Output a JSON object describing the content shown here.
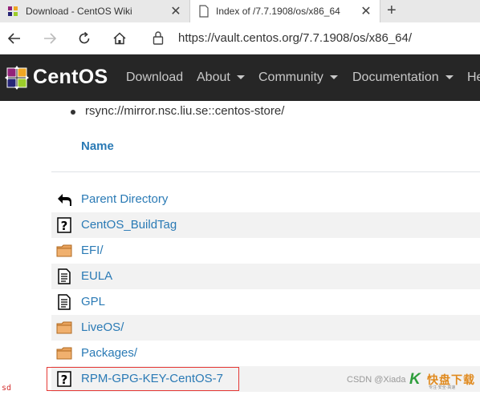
{
  "browser": {
    "tabs": [
      {
        "title": "Download - CentOS Wiki",
        "active": false
      },
      {
        "title": "Index of /7.7.1908/os/x86_64",
        "active": true
      }
    ],
    "new_tab_glyph": "+",
    "close_glyph": "✕",
    "url": "https://vault.centos.org/7.7.1908/os/x86_64/"
  },
  "site": {
    "brand": "CentOS",
    "menu": [
      {
        "label": "Download",
        "dropdown": false
      },
      {
        "label": "About",
        "dropdown": true
      },
      {
        "label": "Community",
        "dropdown": true
      },
      {
        "label": "Documentation",
        "dropdown": true
      },
      {
        "label": "He",
        "dropdown": false
      }
    ]
  },
  "content": {
    "bullet_text": "rsync://mirror.nsc.liu.se::centos-store/",
    "column_header": "Name",
    "rows": [
      {
        "name": "Parent Directory",
        "icon": "back-icon"
      },
      {
        "name": "CentOS_BuildTag",
        "icon": "unknown-file-icon"
      },
      {
        "name": "EFI/",
        "icon": "folder-icon"
      },
      {
        "name": "EULA",
        "icon": "text-file-icon"
      },
      {
        "name": "GPL",
        "icon": "text-file-icon"
      },
      {
        "name": "LiveOS/",
        "icon": "folder-icon"
      },
      {
        "name": "Packages/",
        "icon": "folder-icon"
      },
      {
        "name": "RPM-GPG-KEY-CentOS-7",
        "icon": "unknown-file-icon"
      }
    ]
  },
  "overlay": {
    "corner_mark": "sd",
    "watermark": "CSDN @Xiada",
    "logo_k": "K",
    "logo_text": "快盘下载",
    "logo_sub": "专注·安全·高速"
  },
  "colors": {
    "link": "#2a7ab5",
    "header_bg": "#262626",
    "highlight": "#e53935"
  }
}
